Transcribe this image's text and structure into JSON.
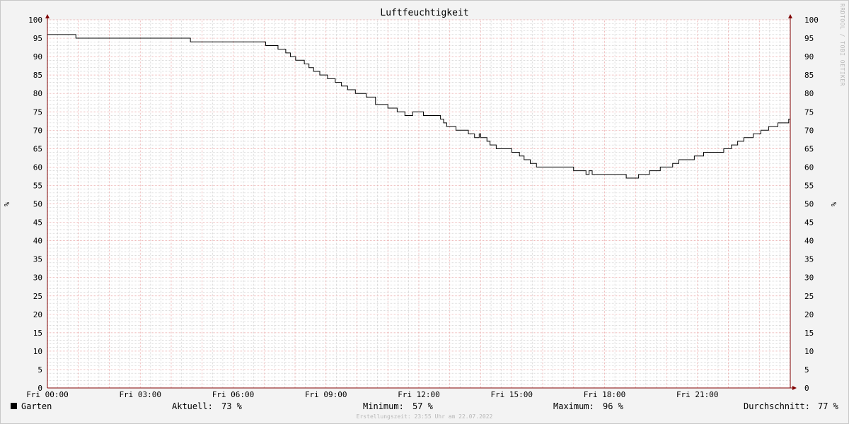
{
  "chart_data": {
    "type": "line",
    "title": "Luftfeuchtigkeit",
    "ylabel": "%",
    "xlim": [
      "00:00",
      "24:00"
    ],
    "ylim": [
      0,
      100
    ],
    "y_ticks": [
      0,
      5,
      10,
      15,
      20,
      25,
      30,
      35,
      40,
      45,
      50,
      55,
      60,
      65,
      70,
      75,
      80,
      85,
      90,
      95,
      100
    ],
    "x_ticks": [
      {
        "label": "Fri 00:00",
        "hour": 0
      },
      {
        "label": "Fri 03:00",
        "hour": 3
      },
      {
        "label": "Fri 06:00",
        "hour": 6
      },
      {
        "label": "Fri 09:00",
        "hour": 9
      },
      {
        "label": "Fri 12:00",
        "hour": 12
      },
      {
        "label": "Fri 15:00",
        "hour": 15
      },
      {
        "label": "Fri 18:00",
        "hour": 18
      },
      {
        "label": "Fri 21:00",
        "hour": 21
      }
    ],
    "grid": true,
    "series": [
      {
        "name": "Garten",
        "color": "#000000",
        "x_hours": [
          0.0,
          0.92,
          4.62,
          7.05,
          7.45,
          7.7,
          7.85,
          8.02,
          8.3,
          8.45,
          8.6,
          8.8,
          9.05,
          9.3,
          9.5,
          9.7,
          9.95,
          10.3,
          10.6,
          11.0,
          11.3,
          11.55,
          11.8,
          12.0,
          12.1,
          12.15,
          12.7,
          12.8,
          12.9,
          13.0,
          13.2,
          13.6,
          13.8,
          13.95,
          14.0,
          14.2,
          14.3,
          14.5,
          14.75,
          15.0,
          15.25,
          15.4,
          15.6,
          15.8,
          16.1,
          17.0,
          17.4,
          17.5,
          17.6,
          18.0,
          18.3,
          18.7,
          19.1,
          19.45,
          19.8,
          20.0,
          20.2,
          20.4,
          20.55,
          20.9,
          21.2,
          21.5,
          21.85,
          22.1,
          22.3,
          22.5,
          22.8,
          23.05,
          23.3,
          23.6,
          23.9,
          23.95,
          24.0
        ],
        "values": [
          96,
          95,
          94,
          93,
          92,
          91,
          90,
          89,
          88,
          87,
          86,
          85,
          84,
          83,
          82,
          81,
          80,
          79,
          77,
          76,
          75,
          74,
          75,
          75,
          75,
          74,
          73,
          72,
          71,
          71,
          70,
          69,
          68,
          69,
          68,
          67,
          66,
          65,
          65,
          64,
          63,
          62,
          61,
          60,
          60,
          59,
          58,
          59,
          58,
          58,
          58,
          57,
          58,
          59,
          60,
          60,
          61,
          62,
          62,
          63,
          64,
          64,
          65,
          66,
          67,
          68,
          69,
          70,
          71,
          72,
          72,
          73,
          73
        ]
      }
    ],
    "legend": {
      "position": "bottom",
      "label": "Garten",
      "stats": [
        {
          "label": "Aktuell:",
          "value": "73 %"
        },
        {
          "label": "Minimum:",
          "value": "57 %"
        },
        {
          "label": "Maximum:",
          "value": "96 %"
        },
        {
          "label": "Durchschnitt:",
          "value": "77 %"
        }
      ]
    },
    "colors": {
      "major_grid": "#e8a0a0",
      "minor_grid": "#c8c8c8",
      "axis": "#800000"
    }
  },
  "watermark": "RRDTOOL / TOBI OETIKER",
  "footer": "Erstellungszeit: 23:55 Uhr am 22.07.2022"
}
